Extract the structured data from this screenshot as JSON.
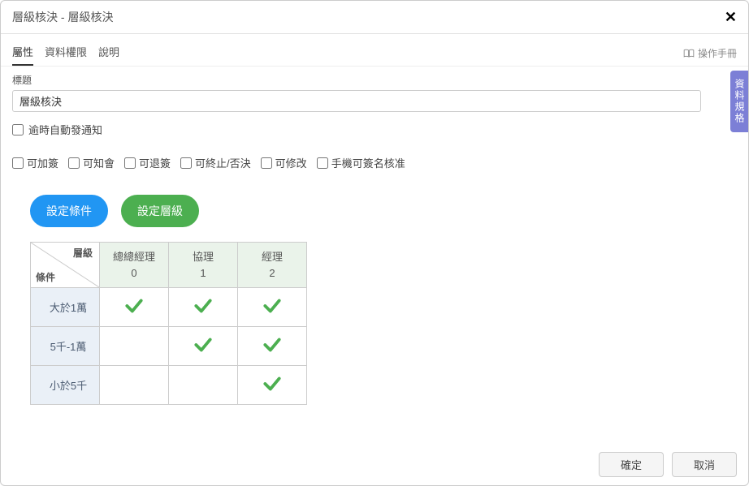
{
  "dialog": {
    "title": "層級核決 - 層級核決"
  },
  "tabs": {
    "items": [
      "屬性",
      "資料權限",
      "說明"
    ],
    "active": 0
  },
  "manual_link": "操作手冊",
  "form": {
    "title_label": "標題",
    "title_value": "層級核決",
    "auto_notify_label": "逾時自動發通知"
  },
  "options": [
    "可加簽",
    "可知會",
    "可退簽",
    "可終止/否決",
    "可修改",
    "手機可簽名核准"
  ],
  "buttons": {
    "set_condition": "設定條件",
    "set_level": "設定層級"
  },
  "matrix": {
    "corner_top": "層級",
    "corner_bottom": "條件",
    "levels": [
      {
        "name": "總總經理",
        "index": "0"
      },
      {
        "name": "協理",
        "index": "1"
      },
      {
        "name": "經理",
        "index": "2"
      }
    ],
    "conditions": [
      "大於1萬",
      "5千-1萬",
      "小於5千"
    ],
    "checks": [
      [
        true,
        true,
        true
      ],
      [
        false,
        true,
        true
      ],
      [
        false,
        false,
        true
      ]
    ]
  },
  "side_tab": "資料規格",
  "footer": {
    "ok": "確定",
    "cancel": "取消"
  }
}
